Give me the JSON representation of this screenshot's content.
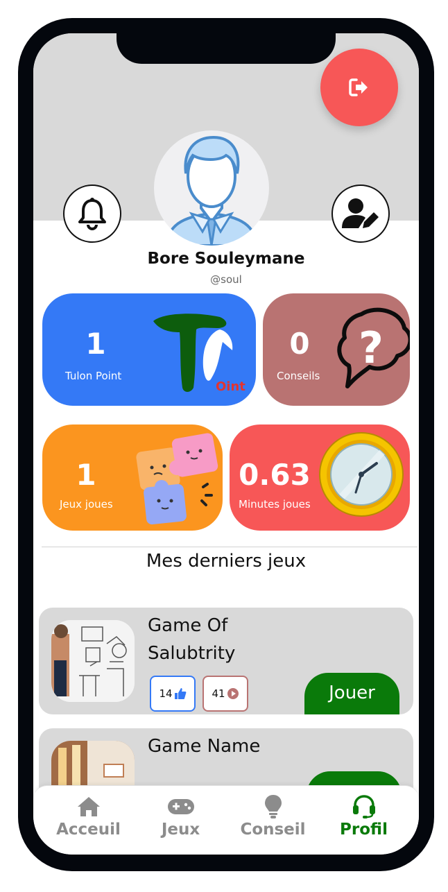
{
  "profile": {
    "name": "Bore Souleymane",
    "handle": "@soul"
  },
  "stats": {
    "points": {
      "value": "1",
      "label": "Tulon Point",
      "logo_text": "Oint"
    },
    "conseils": {
      "value": "0",
      "label": "Conseils"
    },
    "jeux": {
      "value": "1",
      "label": "Jeux joues"
    },
    "minutes": {
      "value": "0.63",
      "label": "Minutes joues"
    }
  },
  "section_title": "Mes derniers jeux",
  "games": [
    {
      "title": "Game Of Salubtrity",
      "likes": "14",
      "plays": "41",
      "play_label": "Jouer"
    },
    {
      "title": "Game Name"
    }
  ],
  "nav": [
    {
      "label": "Acceuil",
      "icon": "home-icon"
    },
    {
      "label": "Jeux",
      "icon": "gamepad-icon"
    },
    {
      "label": "Conseil",
      "icon": "lightbulb-icon"
    },
    {
      "label": "Profil",
      "icon": "headset-icon",
      "active": true
    }
  ],
  "colors": {
    "blue": "#3479f6",
    "brown": "#b97372",
    "orange": "#fb951f",
    "red": "#f75757",
    "green": "#0a7a0a"
  }
}
